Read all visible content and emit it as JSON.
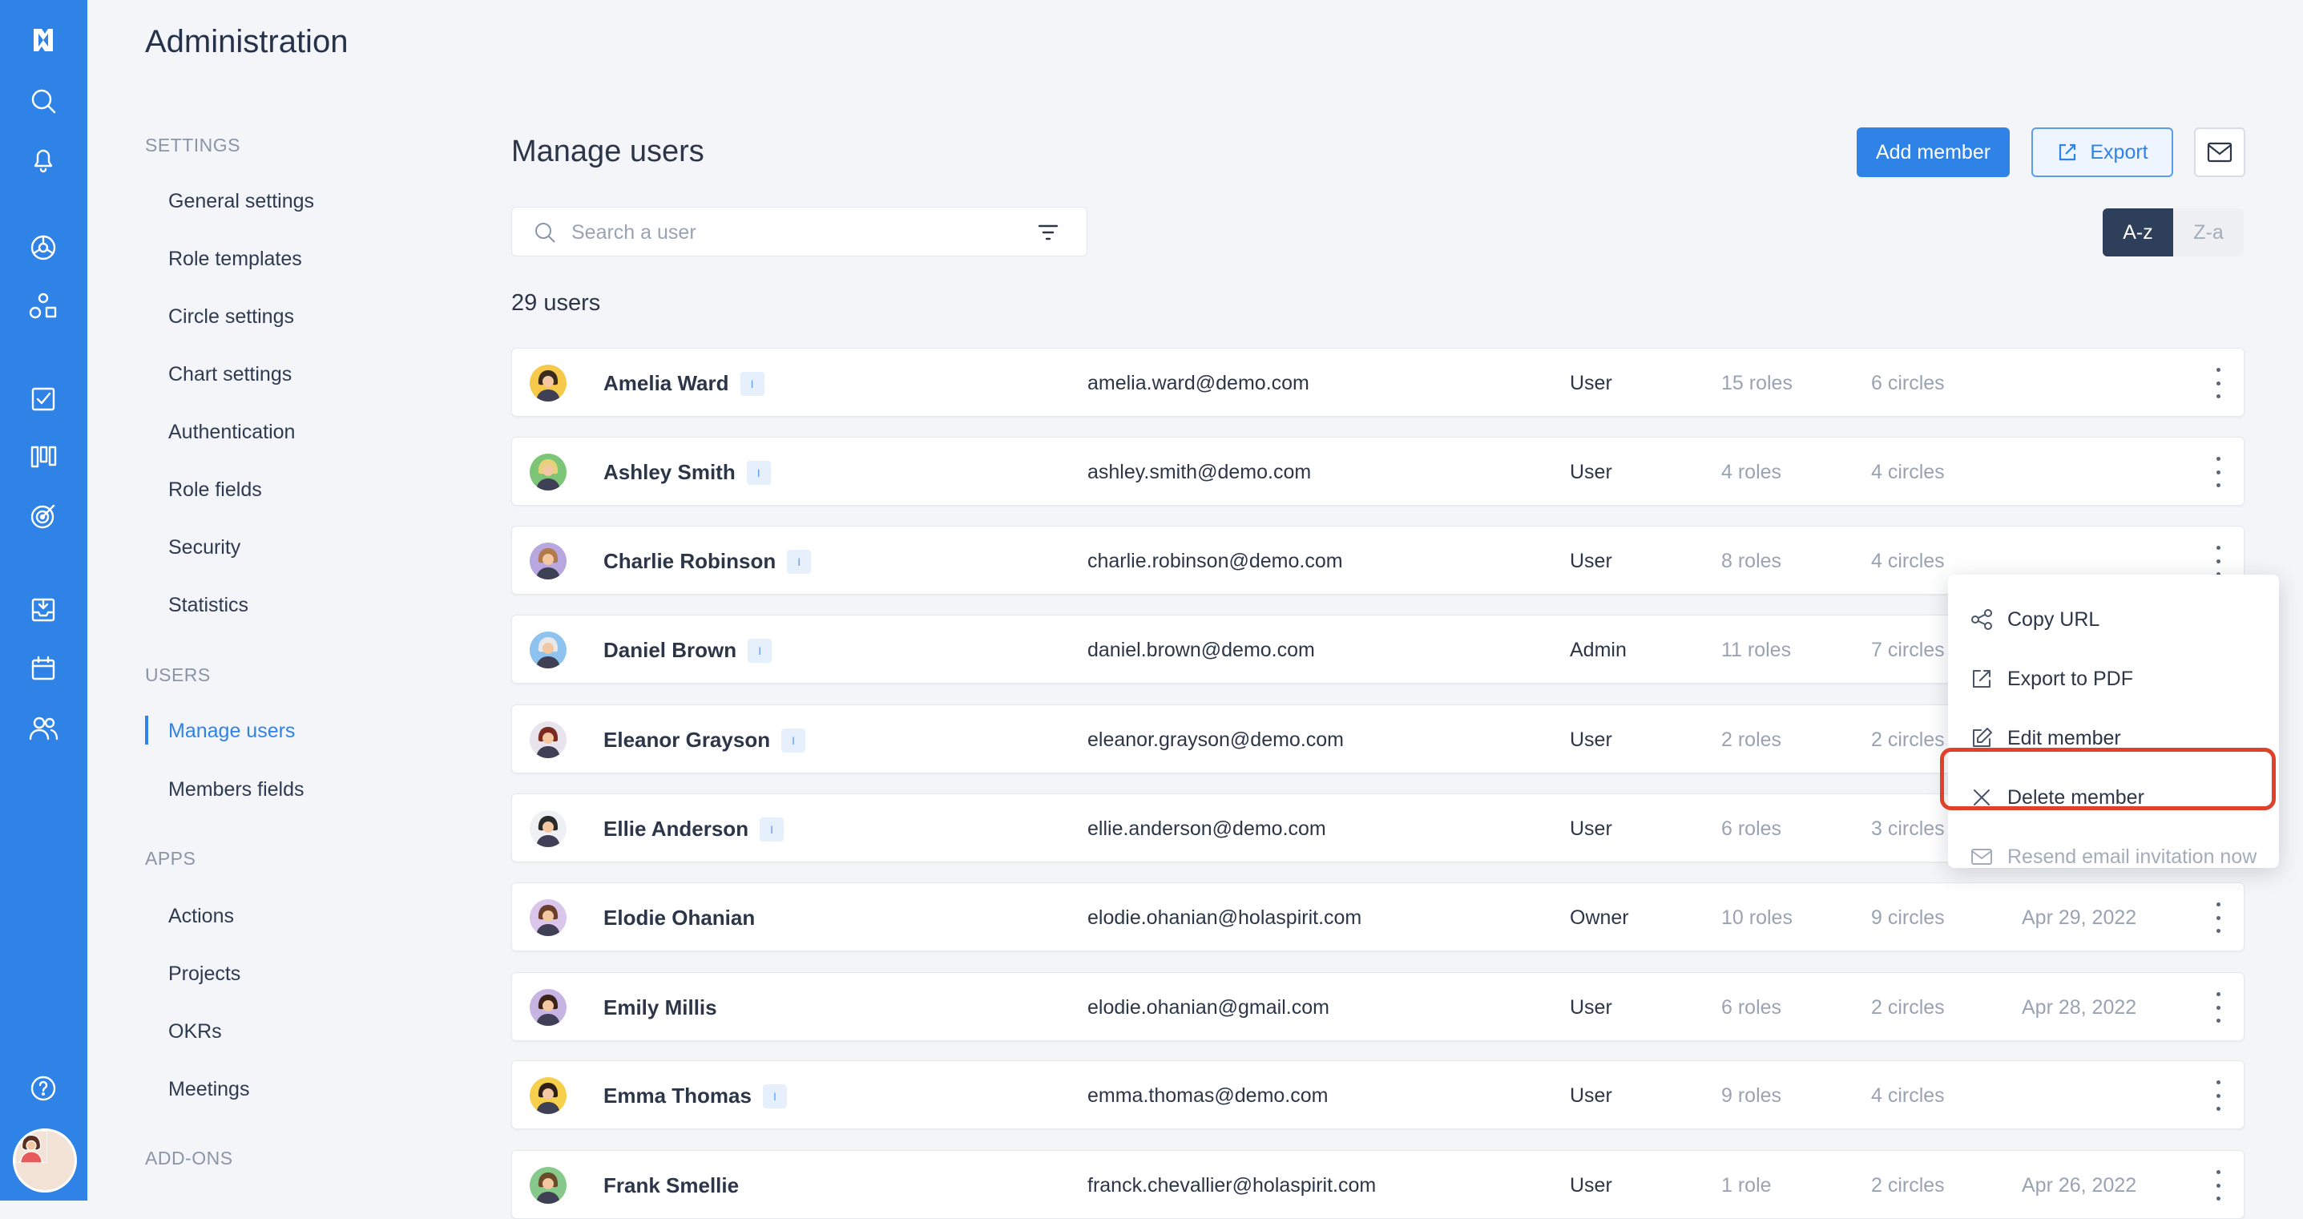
{
  "admin": {
    "title": "Administration"
  },
  "nav": {
    "sections": [
      {
        "label": "SETTINGS",
        "items": [
          "General settings",
          "Role templates",
          "Circle settings",
          "Chart settings",
          "Authentication",
          "Role fields",
          "Security",
          "Statistics"
        ]
      },
      {
        "label": "USERS",
        "items": [
          "Manage users",
          "Members fields"
        ]
      },
      {
        "label": "APPS",
        "items": [
          "Actions",
          "Projects",
          "OKRs",
          "Meetings"
        ]
      },
      {
        "label": "ADD-ONS",
        "items": []
      }
    ],
    "active": "Manage users"
  },
  "main": {
    "title": "Manage users",
    "add_label": "Add member",
    "export_label": "Export",
    "search_placeholder": "Search a user",
    "sort_az": "A-z",
    "sort_za": "Z-a",
    "count": "29 users"
  },
  "rail": {
    "icons": [
      "logo-icon",
      "search-icon",
      "bell-icon",
      "globe-icon",
      "shapes-icon",
      "checkbox-icon",
      "board-icon",
      "target-icon",
      "inbox-icon",
      "calendar-icon",
      "people-icon",
      "help-icon"
    ]
  },
  "users": [
    {
      "name": "Amelia Ward",
      "tag": "I",
      "email": "amelia.ward@demo.com",
      "role": "User",
      "roles": "15 roles",
      "circles": "6 circles",
      "date": "",
      "avatar_bg": "#f6c94a",
      "hair": "#3b2a1e"
    },
    {
      "name": "Ashley Smith",
      "tag": "I",
      "email": "ashley.smith@demo.com",
      "role": "User",
      "roles": "4 roles",
      "circles": "4 circles",
      "date": "",
      "avatar_bg": "#7cc576",
      "hair": "#e7d27a"
    },
    {
      "name": "Charlie Robinson",
      "tag": "I",
      "email": "charlie.robinson@demo.com",
      "role": "User",
      "roles": "8 roles",
      "circles": "4 circles",
      "date": "",
      "avatar_bg": "#b9a7df",
      "hair": "#b07a4a"
    },
    {
      "name": "Daniel Brown",
      "tag": "I",
      "email": "daniel.brown@demo.com",
      "role": "Admin",
      "roles": "11 roles",
      "circles": "7 circles",
      "date": "",
      "avatar_bg": "#8fc3ef",
      "hair": "#e8e8e8"
    },
    {
      "name": "Eleanor Grayson",
      "tag": "I",
      "email": "eleanor.grayson@demo.com",
      "role": "User",
      "roles": "2 roles",
      "circles": "2 circles",
      "date": "",
      "avatar_bg": "#e9e3ee",
      "hair": "#7a2a1e"
    },
    {
      "name": "Ellie Anderson",
      "tag": "I",
      "email": "ellie.anderson@demo.com",
      "role": "User",
      "roles": "6 roles",
      "circles": "3 circles",
      "date": "",
      "avatar_bg": "#eef0f4",
      "hair": "#2a2a2a"
    },
    {
      "name": "Elodie Ohanian",
      "tag": "",
      "email": "elodie.ohanian@holaspirit.com",
      "role": "Owner",
      "roles": "10 roles",
      "circles": "9 circles",
      "date": "Apr 29, 2022",
      "avatar_bg": "#d9c6ea",
      "hair": "#6b3d2a"
    },
    {
      "name": "Emily Millis",
      "tag": "",
      "email": "elodie.ohanian@gmail.com",
      "role": "User",
      "roles": "6 roles",
      "circles": "2 circles",
      "date": "Apr 28, 2022",
      "avatar_bg": "#c8b4e3",
      "hair": "#3a2418"
    },
    {
      "name": "Emma Thomas",
      "tag": "I",
      "email": "emma.thomas@demo.com",
      "role": "User",
      "roles": "9 roles",
      "circles": "4 circles",
      "date": "",
      "avatar_bg": "#f6d04d",
      "hair": "#2f2018"
    },
    {
      "name": "Frank Smellie",
      "tag": "",
      "email": "franck.chevallier@holaspirit.com",
      "role": "User",
      "roles": "1 role",
      "circles": "2 circles",
      "date": "Apr 26, 2022",
      "avatar_bg": "#86c98a",
      "hair": "#6b4a2a"
    }
  ],
  "menu": {
    "items": [
      {
        "label": "Copy URL",
        "icon": "share-icon",
        "disabled": false
      },
      {
        "label": "Export to PDF",
        "icon": "external-link-icon",
        "disabled": false
      },
      {
        "label": "Edit member",
        "icon": "edit-icon",
        "disabled": false
      },
      {
        "label": "Delete member",
        "icon": "close-icon",
        "disabled": false
      },
      {
        "label": "Resend email invitation now",
        "icon": "mail-icon",
        "disabled": true
      }
    ],
    "highlight_color": "#e0412a"
  },
  "colors": {
    "brand": "#2f82e6",
    "dark": "#2e3f5c"
  }
}
